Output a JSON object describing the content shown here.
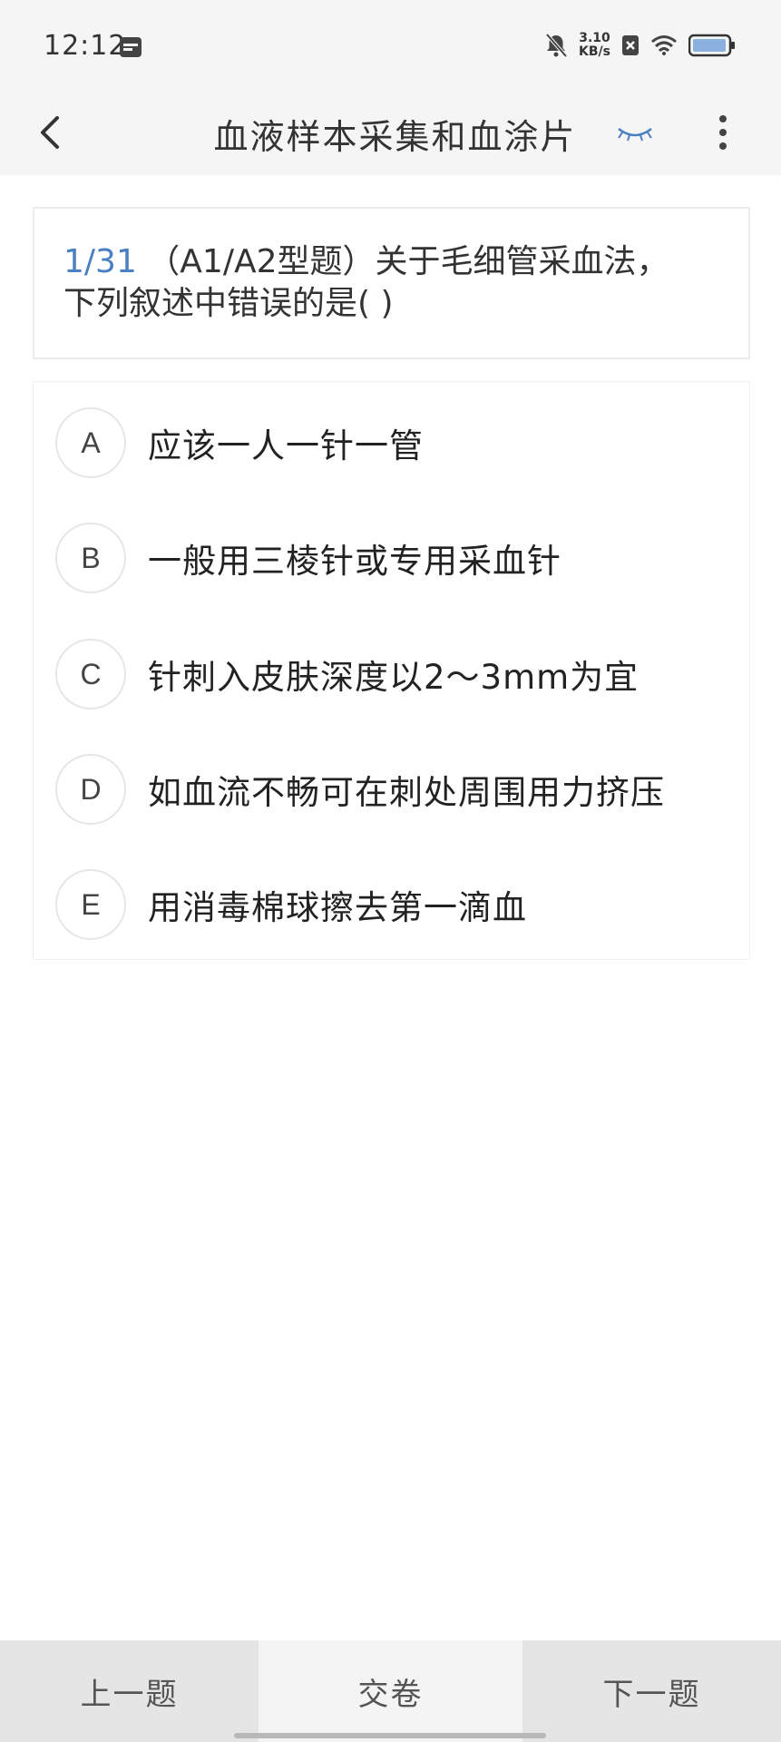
{
  "status_bar": {
    "time": "12:12",
    "net_speed_value": "3.10",
    "net_speed_unit": "KB/s",
    "icons": [
      "calendar-icon",
      "bell-muted-icon",
      "sim-x-icon",
      "wifi-icon",
      "battery-icon"
    ]
  },
  "header": {
    "title": "血液样本采集和血涂片",
    "accent_color": "#4a7fc1"
  },
  "question": {
    "index": "1/31",
    "text_line1": "（A1/A2型题）关于毛细管采血法，",
    "text_line2": "下列叙述中错误的是( )"
  },
  "options": [
    {
      "letter": "A",
      "text": "应该一人一针一管"
    },
    {
      "letter": "B",
      "text": "一般用三棱针或专用采血针"
    },
    {
      "letter": "C",
      "text": "针刺入皮肤深度以2～3mm为宜"
    },
    {
      "letter": "D",
      "text": "如血流不畅可在刺处周围用力挤压"
    },
    {
      "letter": "E",
      "text": "用消毒棉球擦去第一滴血"
    }
  ],
  "bottom": {
    "prev_label": "上一题",
    "submit_label": "交卷",
    "next_label": "下一题"
  }
}
